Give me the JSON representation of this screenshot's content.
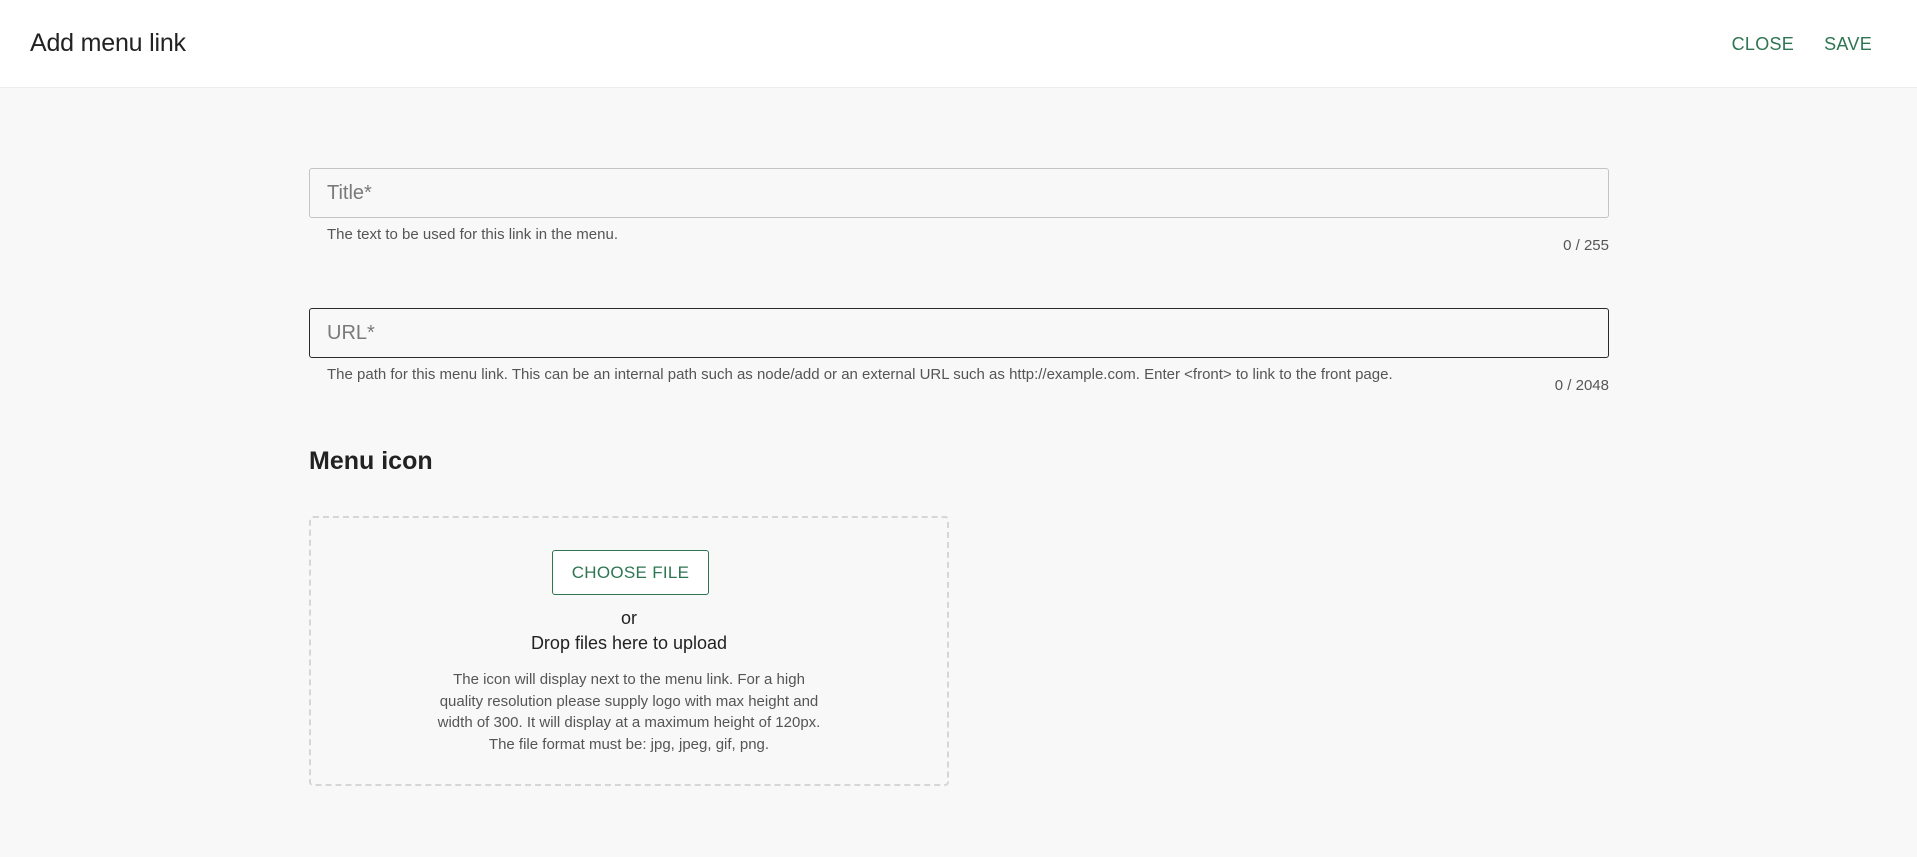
{
  "header": {
    "title": "Add menu link",
    "close_label": "CLOSE",
    "save_label": "SAVE"
  },
  "title_field": {
    "placeholder": "Title*",
    "value": "",
    "help": "The text to be used for this link in the menu.",
    "counter": "0 / 255"
  },
  "url_field": {
    "placeholder": "URL*",
    "value": "",
    "help": "The path for this menu link. This can be an internal path such as node/add or an external URL such as http://example.com. Enter <front> to link to the front page.",
    "counter": "0 / 2048"
  },
  "menu_icon": {
    "section_title": "Menu icon",
    "choose_file_label": "CHOOSE FILE",
    "or_text": "or",
    "drop_text": "Drop files here to upload",
    "help": "The icon will display next to the menu link. For a high quality resolution please supply logo with max height and width of 300. It will display at a maximum height of 120px. The file format must be: jpg, jpeg, gif, png."
  },
  "colors": {
    "accent": "#2e7552",
    "background": "#f8f8f8",
    "header_background": "#ffffff"
  }
}
